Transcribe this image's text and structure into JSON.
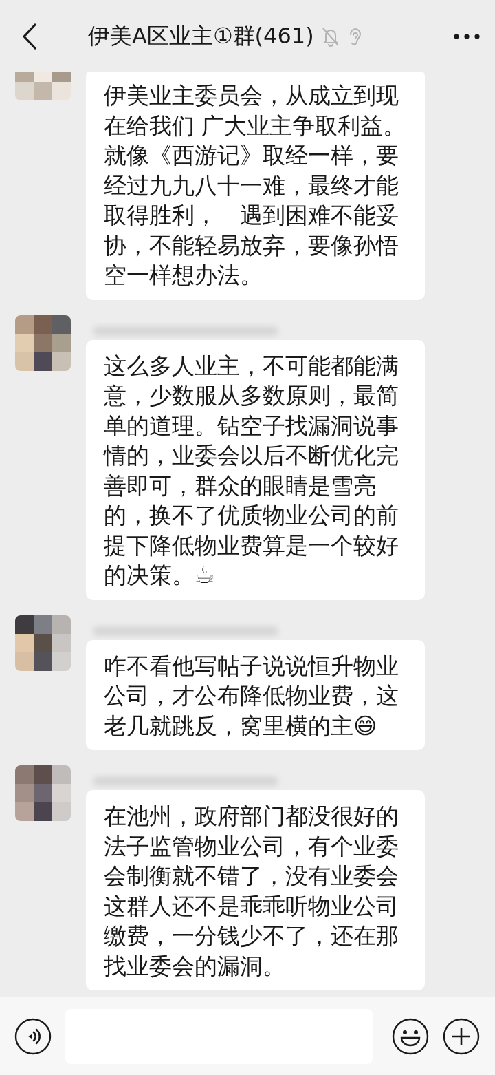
{
  "header": {
    "title": "伊美A区业主①群(461)",
    "muted": true,
    "earpiece": true
  },
  "messages": [
    {
      "text": "伊美业主委员会，从成立到现在给我们 广大业主争取利益。就像《西游记》取经一样，要经过九九八十一难，最终才能取得胜利，　遇到困难不能妥协，不能轻易放弃，要像孙悟空一样想办法。"
    },
    {
      "text": "这么多人业主，不可能都能满意，少数服从多数原则，最简单的道理。钻空子找漏洞说事情的，业委会以后不断优化完善即可，群众的眼睛是雪亮的，换不了优质物业公司的前提下降低物业费算是一个较好的决策。☕"
    },
    {
      "text": "咋不看他写帖子说说恒升物业公司，才公布降低物业费，这老几就跳反，窝里横的主😄"
    },
    {
      "text": "在池州，政府部门都没很好的法子监管物业公司，有个业委会制衡就不错了，没有业委会这群人还不是乖乖听物业公司缴费，一分钱少不了，还在那找业委会的漏洞。"
    }
  ]
}
